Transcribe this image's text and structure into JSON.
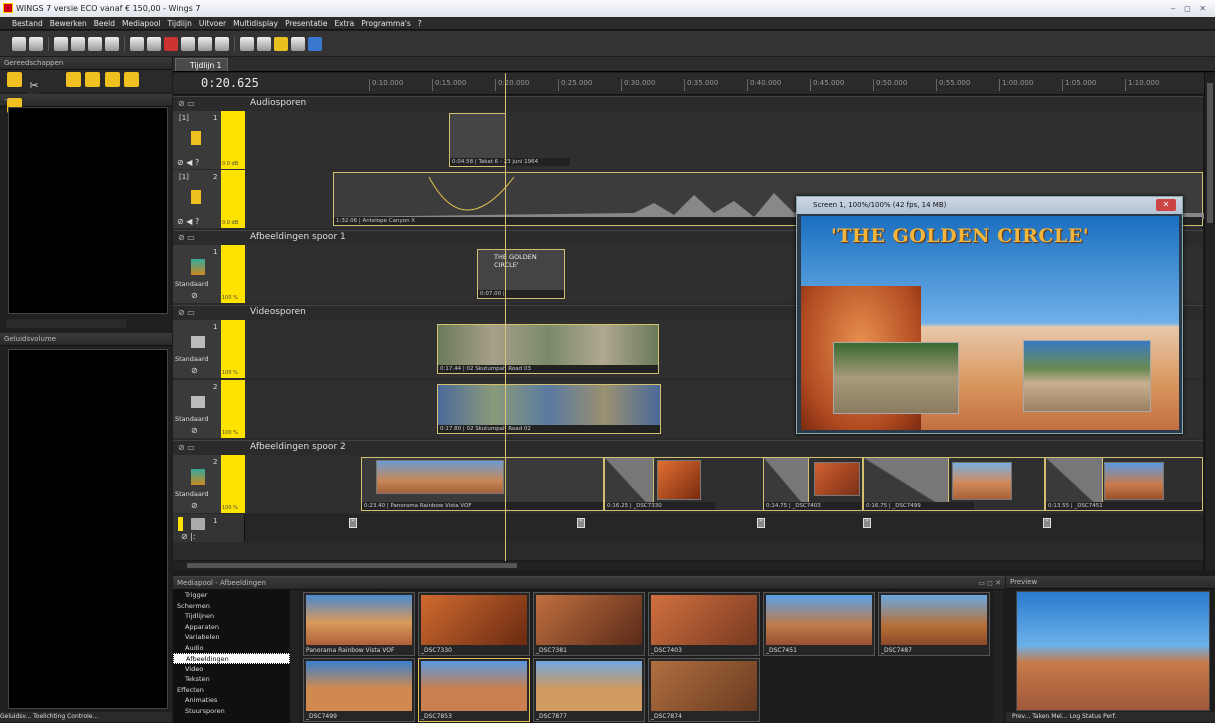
{
  "window": {
    "title": "WINGS 7 versie ECO vanaf € 150,00 - Wings 7"
  },
  "menu": [
    "Bestand",
    "Bewerken",
    "Beeld",
    "Mediapool",
    "Tijdlijn",
    "Uitvoer",
    "Multidisplay",
    "Presentatie",
    "Extra",
    "Programma's",
    "?"
  ],
  "panels": {
    "tools": "Gereedschappen",
    "empty": "----",
    "volume": "Geluidsvolume",
    "mediapool": "Mediapool - Afbeeldingen",
    "preview": "Preview"
  },
  "timeline": {
    "tab": "Tijdlijn 1",
    "timecode": "0:20.625",
    "ticks": [
      "0:10.000",
      "0:15.000",
      "0:20.000",
      "0:25.000",
      "0:30.000",
      "0:35.000",
      "0:40.000",
      "0:45.000",
      "0:50.000",
      "0:55.000",
      "1:00.000",
      "1:05.000",
      "1:10.000"
    ],
    "sections": [
      "Audiosporen",
      "Afbeeldingen spoor 1",
      "Videosporen",
      "Afbeeldingen spoor 2"
    ],
    "track_labels": {
      "a1": "[1]",
      "a2": "[1]",
      "n1": "1",
      "n2": "2",
      "std": "Standaard",
      "db": "0.0 dB",
      "pct": "100 %"
    },
    "clips": {
      "audio1": "0:04.58 | Takat 6 - 23 juni 1964",
      "audio2": "1:32.06 | Antelope Canyon X",
      "title_text": "THE GOLDEN CIRCLE'",
      "title_dur": "0:07.00 |",
      "video1": "0:17.44 | 02 Skutumpah Road 03",
      "video2": "0:17.80 | 02 Skutumpah Road 02",
      "img1": "0:23.40 | Panorama Rainbow Vista VOF",
      "img2": "0:16.25 | _DSC7330",
      "img3": "0:14.75 | _DSC7403",
      "img4": "0:16.75 | _DSC7499",
      "img5": "0:13.55 | _DSC7451"
    }
  },
  "screen_window": {
    "title": "Screen 1, 100%/100% (42 fps, 14 MB)",
    "headline": "'THE GOLDEN CIRCLE'"
  },
  "mediapool": {
    "tree": [
      "Trigger",
      "Schermen",
      "Tijdlijnen",
      "Apparaten",
      "Variabelen",
      "Audio",
      "Afbeeldingen",
      "Video",
      "Teksten",
      "Effecten",
      "Animaties",
      "Stuursporen"
    ],
    "thumbs": [
      "Panorama Rainbow Vista VOF",
      "_DSC7330",
      "_DSC7381",
      "_DSC7403",
      "_DSC7451",
      "_DSC7487",
      "_DSC7499",
      "_DSC7853",
      "_DSC7877",
      "_DSC7874"
    ]
  },
  "status": {
    "left_tabs": "Geluidsv... Toelichting Controle...",
    "right_tabs": "Prev... Taken Mel... Log Status Perf."
  }
}
